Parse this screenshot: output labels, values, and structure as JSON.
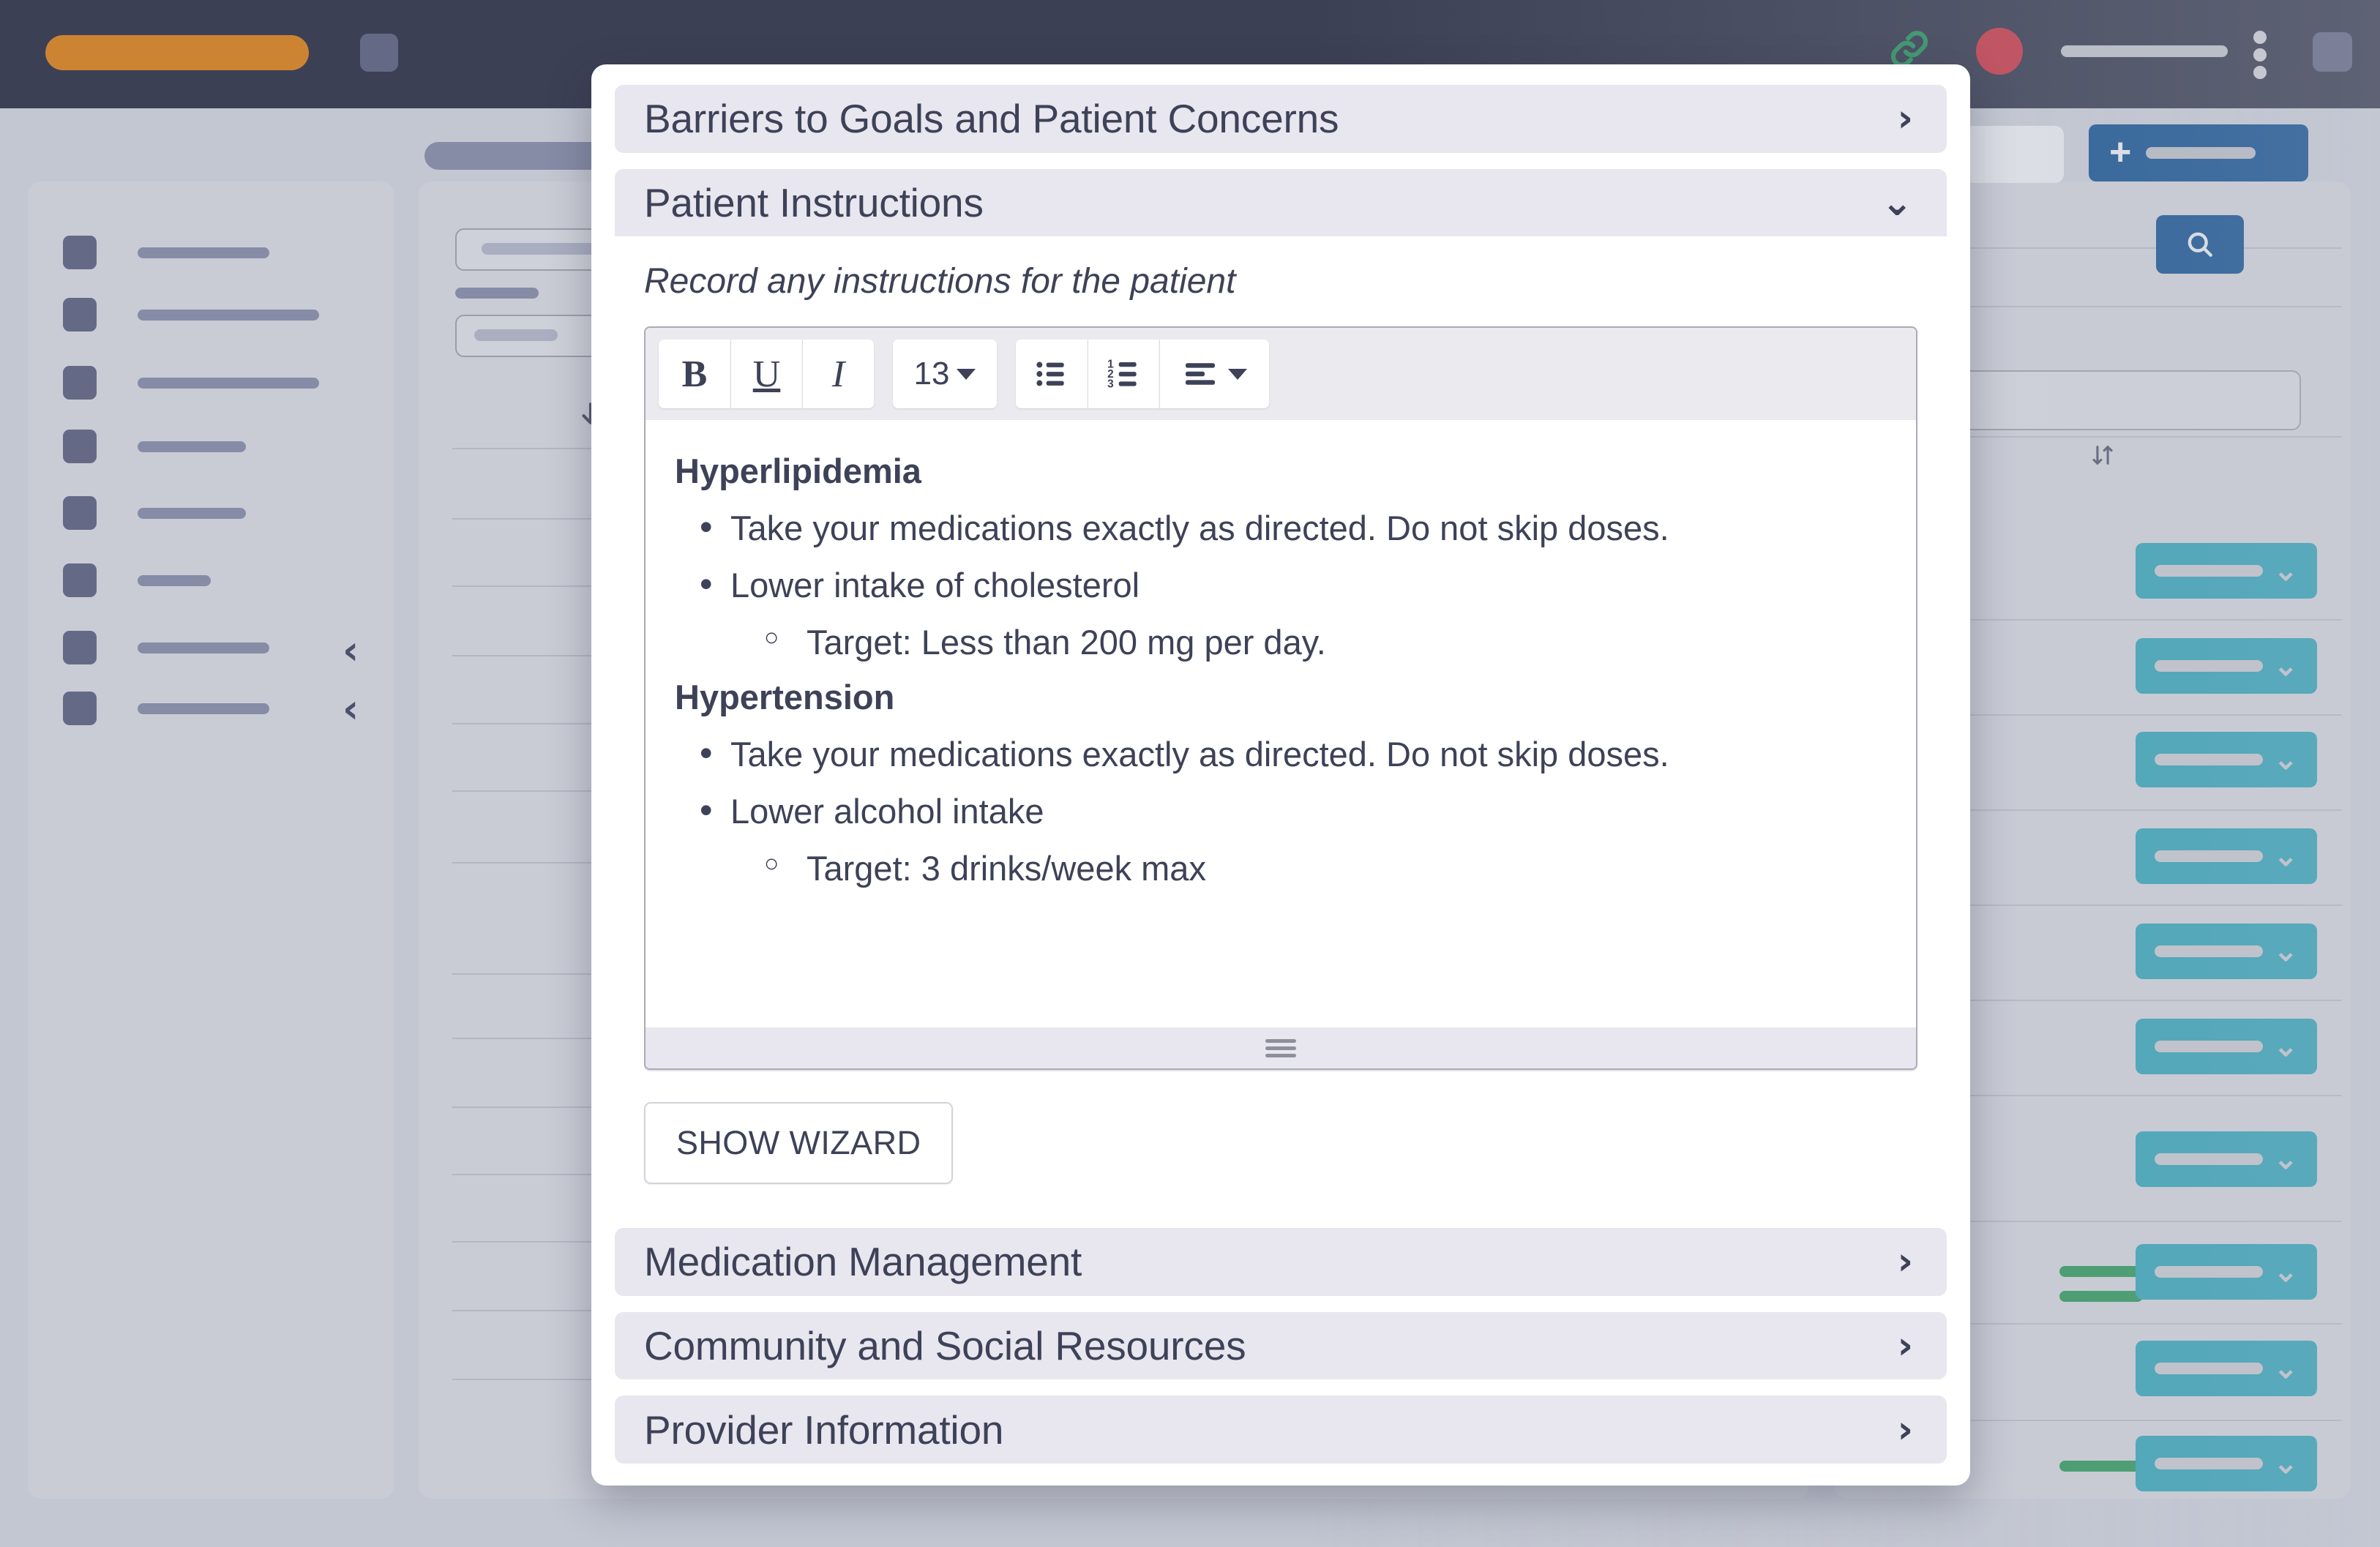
{
  "background": {
    "colors": {
      "topbar": "#3c4055",
      "logo_pill": "#cc8433",
      "avatar": "#c0404f",
      "link_icon": "#2f9263",
      "panel": "#c9ccd5",
      "desktop": "#c3c7d2",
      "primary_button": "#1c5591",
      "select_button": "#38a0b4",
      "status_good": "#33955f",
      "status_neutral": "#868ca6"
    },
    "icons": {
      "link": "link-icon",
      "kebab": "more-vertical-icon",
      "plus": "plus-icon",
      "search": "search-icon",
      "sort": "sort-icon",
      "arrow_down": "arrow-down-icon",
      "collapse": "chevron-left-icon",
      "select_chevron": "chevron-down-icon"
    },
    "sidebar_item_count": 8,
    "row_count": 12
  },
  "modal": {
    "sections": [
      {
        "label": "Barriers to Goals and Patient Concerns",
        "state": "collapsed",
        "chevron": "›"
      },
      {
        "label": "Patient Instructions",
        "state": "expanded",
        "chevron": "⌄"
      },
      {
        "label": "Medication Management",
        "state": "collapsed",
        "chevron": "›"
      },
      {
        "label": "Community and Social Resources",
        "state": "collapsed",
        "chevron": "›"
      },
      {
        "label": "Provider Information",
        "state": "collapsed",
        "chevron": "›"
      }
    ],
    "patient_instructions": {
      "subtitle": "Record any instructions for the patient",
      "toolbar": {
        "bold_label": "B",
        "underline_label": "U",
        "italic_label": "I",
        "font_size_value": "13",
        "bullet_list_label": "bulleted-list",
        "numbered_list_label": "numbered-list",
        "align_label": "align"
      },
      "editor_content": [
        {
          "heading": "Hyperlipidemia",
          "items": [
            {
              "text": "Take your medications exactly as directed. Do not skip doses.",
              "level": 1
            },
            {
              "text": "Lower intake of cholesterol",
              "level": 1
            },
            {
              "text": "Target: Less than 200 mg per day.",
              "level": 2
            }
          ]
        },
        {
          "heading": "Hypertension",
          "items": [
            {
              "text": "Take your medications exactly as directed. Do not skip doses.",
              "level": 1
            },
            {
              "text": "Lower alcohol intake",
              "level": 1
            },
            {
              "text": "Target: 3 drinks/week max",
              "level": 2
            }
          ]
        }
      ],
      "wizard_button_label": "SHOW WIZARD"
    }
  }
}
